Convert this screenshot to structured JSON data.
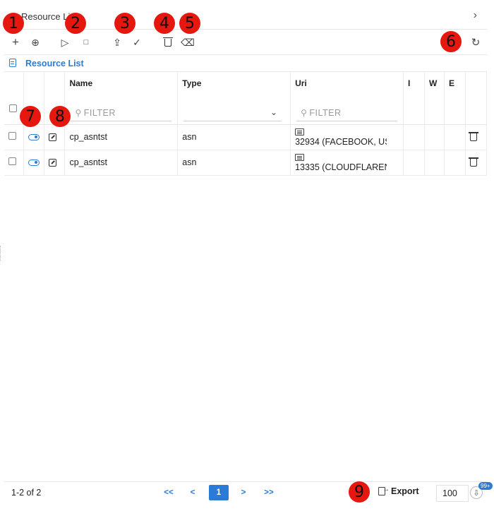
{
  "breadcrumb": {
    "title": "Resource List"
  },
  "toolbar": {
    "add": "+",
    "add_circle": "⊕",
    "play": "▷",
    "stop": "□",
    "upload": "⇪",
    "check": "✓",
    "delete": "🗑",
    "erase": "⌫",
    "refresh": "↻"
  },
  "resource_list": {
    "title": "Resource List"
  },
  "table": {
    "columns": [
      "",
      "",
      "",
      "Name",
      "Type",
      "Uri",
      "I",
      "W",
      "E",
      ""
    ],
    "filter_placeholder": "FILTER",
    "rows": [
      {
        "name": "cp_asntst",
        "type": "asn",
        "uri": "32934 (FACEBOOK, US"
      },
      {
        "name": "cp_asntst",
        "type": "asn",
        "uri": "13335 (CLOUDFLAREN"
      }
    ]
  },
  "footer": {
    "range": "1-2 of 2",
    "first": "<<",
    "prev": "<",
    "page": "1",
    "next": ">",
    "last": ">>",
    "export": "Export",
    "page_size": "100",
    "badge": "99+"
  },
  "markers": [
    "1",
    "2",
    "3",
    "4",
    "5",
    "6",
    "7",
    "8",
    "9"
  ],
  "colors": {
    "accent": "#2b7bd6",
    "marker": "#e5170f"
  }
}
